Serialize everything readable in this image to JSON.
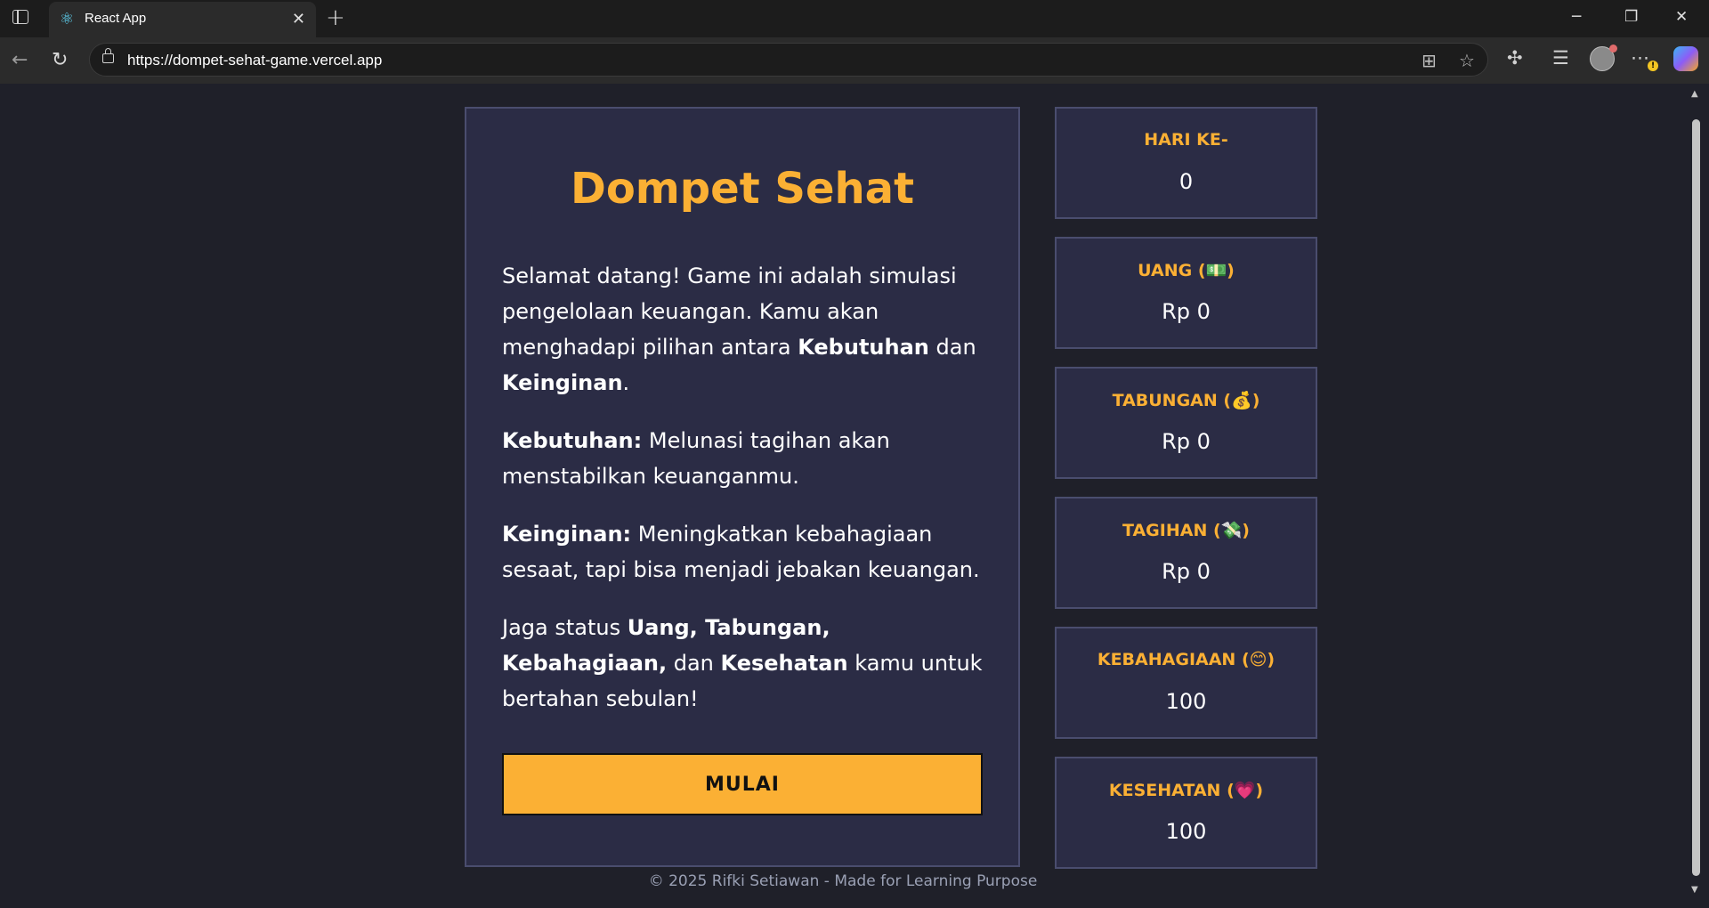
{
  "browser": {
    "tab_title": "React App",
    "url": "https://dompet-sehat-game.vercel.app",
    "icons": {
      "tab_favicon": "react-logo-icon",
      "back": "arrow-left-icon",
      "reload": "reload-icon",
      "lock": "lock-icon"
    }
  },
  "game": {
    "title": "Dompet Sehat",
    "intro": {
      "p1_text": "Selamat datang! Game ini adalah simulasi pengelolaan keuangan. Kamu akan menghadapi pilihan antara ",
      "p1_bold1": "Kebutuhan",
      "p1_mid": " dan ",
      "p1_bold2": "Keinginan",
      "p1_end": ".",
      "p2_bold": "Kebutuhan:",
      "p2_text": " Melunasi tagihan akan menstabilkan keuanganmu.",
      "p3_bold": "Keinginan:",
      "p3_text": " Meningkatkan kebahagiaan sesaat, tapi bisa menjadi jebakan keuangan.",
      "p4_text1": "Jaga status ",
      "p4_bold1": "Uang, Tabungan, Kebahagiaan,",
      "p4_text2": " dan ",
      "p4_bold2": "Kesehatan",
      "p4_text3": " kamu untuk bertahan sebulan!"
    },
    "start_label": "MULAI"
  },
  "stats": [
    {
      "label": "HARI KE-",
      "value": "0"
    },
    {
      "label": "UANG (💵)",
      "value": "Rp 0"
    },
    {
      "label": "TABUNGAN (💰)",
      "value": "Rp 0"
    },
    {
      "label": "TAGIHAN (💸)",
      "value": "Rp 0"
    },
    {
      "label": "KEBAHAGIAAN (😊)",
      "value": "100"
    },
    {
      "label": "KESEHATAN (💗)",
      "value": "100"
    }
  ],
  "footer": "© 2025 Rifki Setiawan - Made for Learning Purpose",
  "colors": {
    "accent": "#fbb034",
    "panel": "#2b2c45",
    "background": "#1f2029"
  }
}
